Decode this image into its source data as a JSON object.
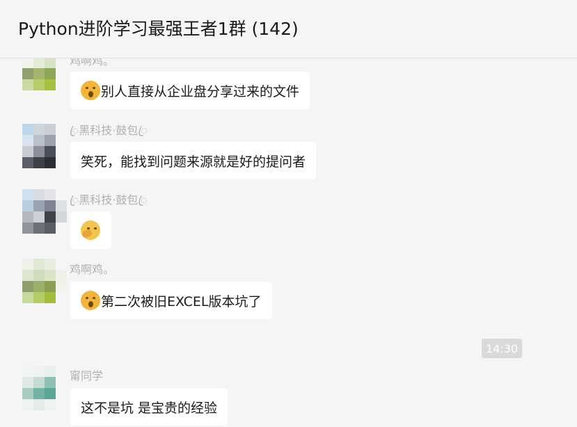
{
  "window": {
    "title": "Python进阶学习最强王者1群 (142)"
  },
  "messages": [
    {
      "sender": "鸡啊鸡。",
      "text": "别人直接从企业盘分享过来的文件",
      "emoji": "facepalm-emoji"
    },
    {
      "sender": "ꦿ黑科技·鼓包ꦿ",
      "text": "笑死，能找到问题来源就是好的提问者",
      "emoji": ""
    },
    {
      "sender": "ꦿ黑科技·鼓包ꦿ",
      "text": "",
      "emoji": "thinking-emoji"
    },
    {
      "sender": "鸡啊鸡。",
      "text": "第二次被旧EXCEL版本坑了",
      "emoji": "facepalm-emoji"
    },
    {
      "sender": "甯同学",
      "text": "这不是坑 是宝贵的经验",
      "emoji": ""
    }
  ],
  "timestamp": "14:30",
  "colors": {
    "background": "#f5f5f5",
    "bubble": "#ffffff",
    "sender": "#b0b0b0",
    "timestamp_bg": "#dadada"
  }
}
